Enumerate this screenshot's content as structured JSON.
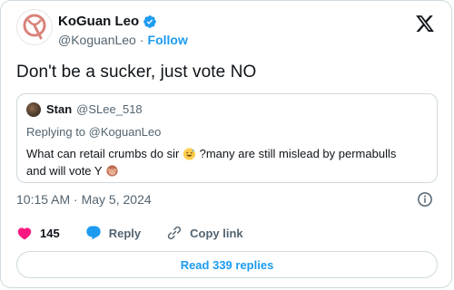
{
  "author": {
    "display_name": "KoGuan Leo",
    "handle": "@KoguanLeo",
    "separator": "·",
    "follow_label": "Follow",
    "verified": true,
    "avatar_icon": "q-logo-avatar"
  },
  "tweet": {
    "text": "Don't be a sucker, just vote NO"
  },
  "quote": {
    "display_name": "Stan",
    "handle": "@SLee_518",
    "replying_to": "Replying to @KoguanLeo",
    "text_part1": "What can retail crumbs do sir",
    "text_part2": " ?many are still mislead by permabulls",
    "text_part3": "and will vote Y",
    "emoji_1": "sweat-smile-emoji",
    "emoji_2": "see-no-evil-monkey-emoji"
  },
  "meta": {
    "timestamp": "10:15 AM · May 5, 2024"
  },
  "actions": {
    "like_count": "145",
    "reply_label": "Reply",
    "copy_link_label": "Copy link"
  },
  "read_replies_label": "Read 339 replies",
  "colors": {
    "accent": "#1d9bf0",
    "like": "#f91880",
    "muted": "#536471",
    "border": "#cfd9de"
  }
}
